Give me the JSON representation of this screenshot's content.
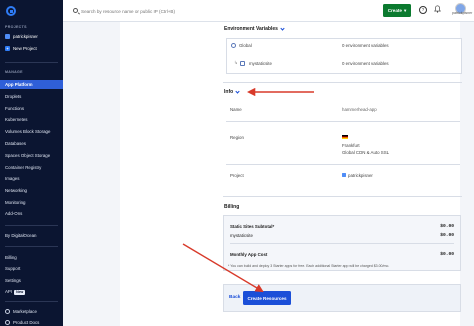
{
  "sidebar": {
    "projects_heading": "PROJECTS",
    "projects": [
      {
        "label": "patrickpisner"
      },
      {
        "label": "New Project"
      }
    ],
    "manage_heading": "MANAGE",
    "items": [
      {
        "label": "App Platform"
      },
      {
        "label": "Droplets"
      },
      {
        "label": "Functions"
      },
      {
        "label": "Kubernetes"
      },
      {
        "label": "Volumes Block Storage"
      },
      {
        "label": "Databases"
      },
      {
        "label": "Spaces Object Storage"
      },
      {
        "label": "Container Registry"
      },
      {
        "label": "Images"
      },
      {
        "label": "Networking"
      },
      {
        "label": "Monitoring"
      },
      {
        "label": "Add-Ons"
      }
    ],
    "by_label": "By DigitalOcean",
    "bottom_items": [
      {
        "label": "Billing"
      },
      {
        "label": "Support"
      },
      {
        "label": "Settings"
      },
      {
        "label": "API"
      }
    ],
    "new_badge": "New",
    "footer_items": [
      {
        "label": "Marketplace"
      },
      {
        "label": "Product Docs"
      }
    ]
  },
  "topbar": {
    "search_placeholder": "Search by resource name or public IP (Ctrl+B)",
    "create_label": "Create",
    "account_label": "patrickpisner"
  },
  "env": {
    "title": "Environment Variables",
    "rows": [
      {
        "name": "Global",
        "value": "0 environment variables"
      },
      {
        "name": "mystaticsite",
        "value": "0 environment variables"
      }
    ]
  },
  "info": {
    "title": "Info",
    "name_label": "Name",
    "name_value": "hammerhead-app",
    "region_label": "Region",
    "region_value": "Frankfurt",
    "region_sub": "Global CDN & Auto SSL",
    "project_label": "Project",
    "project_value": "patrickpisner"
  },
  "billing": {
    "title": "Billing",
    "rows": [
      {
        "label": "Static Sites Subtotal*",
        "price": "$0.00",
        "bold": true
      },
      {
        "label": "mystaticsite",
        "price": "$0.00",
        "bold": false
      },
      {
        "label": "Monthly App Cost",
        "price": "$0.00",
        "bold": true
      }
    ],
    "note": "* You can build and deploy 3 Starter apps for free. Each additional Starter app will be charged $3.00/mo."
  },
  "actions": {
    "back_label": "Back",
    "create_resources_label": "Create Resources"
  },
  "colors": {
    "sidebar_bg": "#0b1531",
    "sidebar_active": "#2f5fd8",
    "primary": "#1b4fd8",
    "create_green": "#0b7a2f",
    "arrow_red": "#d83a2a"
  }
}
